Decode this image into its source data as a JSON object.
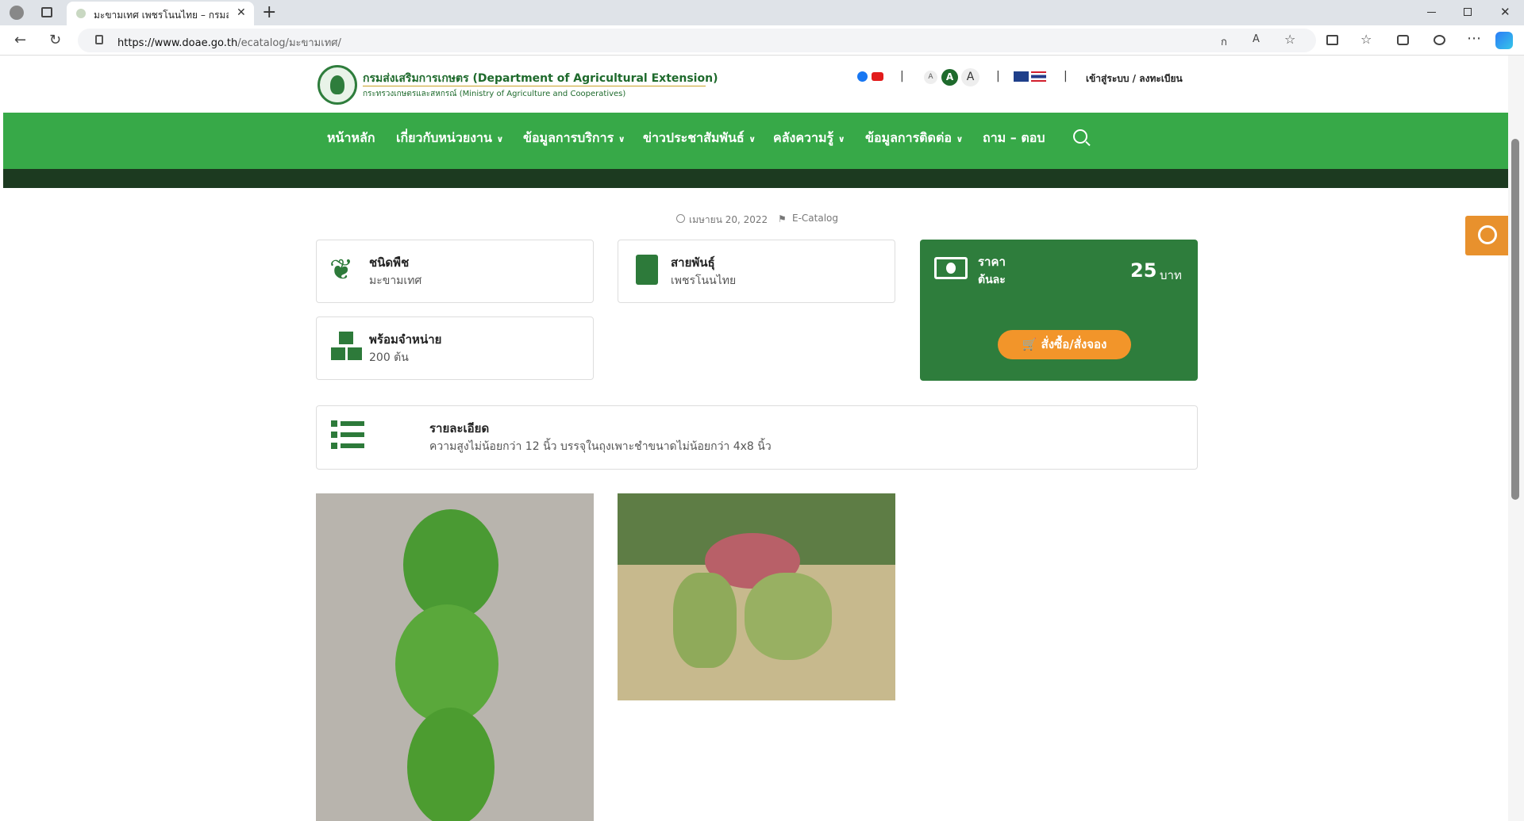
{
  "browser": {
    "tab_title": "มะขามเทศ เพชรโนนไทย – กรมส่งเสริม...",
    "url_prefix": "https://www.doae.go.th",
    "url_path": "/ecatalog/มะขามเทศ/",
    "new_tab": "+"
  },
  "header": {
    "org_name": "กรมส่งเสริมการเกษตร (Department of Agricultural Extension)",
    "org_sub": "กระทรวงเกษตรและสหกรณ์ (Ministry of Agriculture and Cooperatives)",
    "font_small": "A",
    "font_medium": "A",
    "font_large": "A",
    "separator": "|",
    "login": "เข้าสู่ระบบ / ลงทะเบียน"
  },
  "nav": {
    "items": [
      "หน้าหลัก",
      "เกี่ยวกับหน่วยงาน",
      "ข้อมูลการบริการ",
      "ข่าวประชาสัมพันธ์",
      "คลังความรู้",
      "ข้อมูลการติดต่อ",
      "ถาม – ตอบ"
    ]
  },
  "meta": {
    "date": "เมษายน 20, 2022",
    "category": "E-Catalog"
  },
  "cards": {
    "plant_type_title": "ชนิดพืช",
    "plant_type_value": "มะขามเทศ",
    "variety_title": "สายพันธุ์",
    "variety_value": "เพชรโนนไทย",
    "stock_title": "พร้อมจำหน่าย",
    "stock_value": "200 ต้น",
    "detail_title": "รายละเอียด",
    "detail_value": "ความสูงไม่น้อยกว่า 12 นิ้ว บรรจุในถุงเพาะชำขนาดไม่น้อยกว่า 4x8 นิ้ว"
  },
  "price": {
    "label": "ราคา",
    "unit_label": "ต้นละ",
    "amount": "25",
    "currency": "บาท",
    "order_button": "สั่งซื้อ/สั่งจอง"
  },
  "colors": {
    "nav_green": "#37a948",
    "dark_green": "#1c3a20",
    "price_green": "#2e7d3c",
    "order_orange": "#f2952a"
  }
}
